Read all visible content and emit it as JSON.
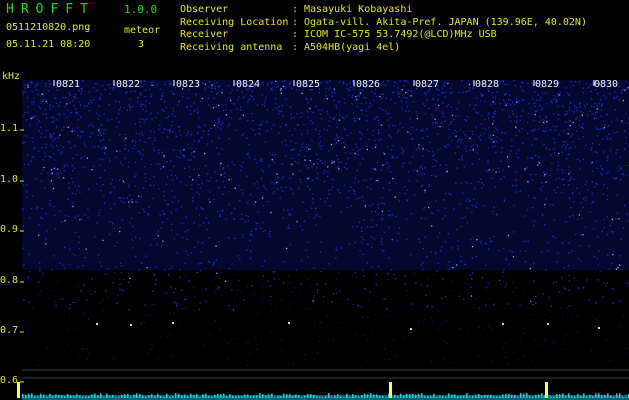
{
  "app": {
    "title": "HROFFT",
    "version": "1.0.0",
    "file_name": "0511210820.png",
    "datetime": "05.11.21 08:20",
    "meteor_label": "meteor",
    "meteor_count": "3"
  },
  "info": [
    {
      "key": "Observer",
      "value": "Masayuki Kobayashi"
    },
    {
      "key": "Receiving Location",
      "value": "Ogata-vill. Akita-Pref. JAPAN (139.96E, 40.02N)"
    },
    {
      "key": "Receiver",
      "value": "ICOM IC-575 53.7492(@LCD)MHz USB"
    },
    {
      "key": "Receiving antenna",
      "value": "A504HB(yagi 4el)"
    }
  ],
  "axis": {
    "y_unit": "kHz",
    "y_ticks": [
      "1.1",
      "1.0",
      "0.9",
      "0.8",
      "0.7",
      "0.6"
    ],
    "x_ticks": [
      "0821",
      "0822",
      "0823",
      "0824",
      "0825",
      "0826",
      "0827",
      "0828",
      "0829",
      "0830"
    ]
  },
  "colors": {
    "label": "#e8e800",
    "title": "#11e011",
    "noise": "#1a2cd6",
    "echo": "#9fe8ff",
    "baseline": "#00d8e8",
    "meteor_spike": "#ffff40"
  },
  "meteors": [
    {
      "time": "0820.4",
      "label": "meteor"
    },
    {
      "time": "0826.6",
      "label": "meteor"
    },
    {
      "time": "0829.2",
      "label": "meteor"
    }
  ]
}
